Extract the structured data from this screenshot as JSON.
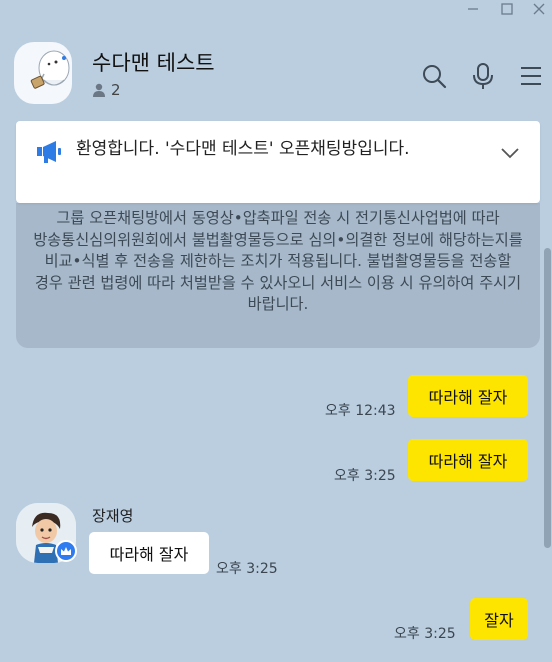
{
  "room": {
    "title": "수다맨 테스트",
    "member_count": "2"
  },
  "header_icons": [
    "search-icon",
    "mic-icon",
    "menu-icon"
  ],
  "window_controls": [
    "minimize-icon",
    "maximize-icon",
    "close-icon"
  ],
  "notice": {
    "text": "환영합니다. '수다맨 테스트' 오픈채팅방입니다."
  },
  "system_message": {
    "text": "그룹 오픈채팅방에서 동영상•압축파일 전송 시 전기통신사업법에 따라 방송통신심의위원회에서 불법촬영물등으로 심의•의결한 정보에 해당하는지를 비교•식별 후 전송을 제한하는 조치가 적용됩니다. 불법촬영물등을 전송할 경우 관련 법령에 따라 처벌받을 수 있사오니 서비스 이용 시 유의하여 주시기 바랍니다."
  },
  "messages": [
    {
      "from": "me",
      "text": "따라해 잘자",
      "time": "오후 12:43"
    },
    {
      "from": "me",
      "text": "따라해 잘자",
      "time": "오후 3:25"
    },
    {
      "from": "other",
      "sender": "장재영",
      "text": "따라해 잘자",
      "time": "오후 3:25"
    },
    {
      "from": "me",
      "text": "잘자",
      "time": "오후 3:25"
    }
  ],
  "colors": {
    "background": "#bacee0",
    "my_bubble": "#fee500",
    "other_bubble": "#ffffff",
    "notice_icon": "#2d7be5"
  }
}
